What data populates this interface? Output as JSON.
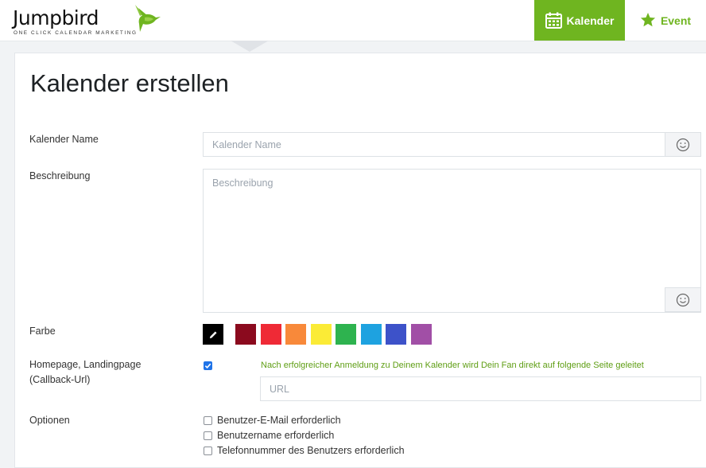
{
  "header": {
    "logo_text": "Jumpbird",
    "logo_tagline": "ONE CLICK CALENDAR MARKETING",
    "nav": [
      {
        "label": "Kalender",
        "icon": "calendar-icon",
        "active": true
      },
      {
        "label": "Event",
        "icon": "star-icon",
        "active": false
      }
    ],
    "accent_color": "#6fb520"
  },
  "page": {
    "title": "Kalender erstellen"
  },
  "form": {
    "name": {
      "label": "Kalender Name",
      "placeholder": "Kalender Name",
      "value": ""
    },
    "description": {
      "label": "Beschreibung",
      "placeholder": "Beschreibung",
      "value": ""
    },
    "color": {
      "label": "Farbe",
      "selected": "#000000",
      "swatches": [
        "#000000",
        "#8b0a1e",
        "#ef2a36",
        "#f8893a",
        "#fbeb36",
        "#2eb34f",
        "#1ea2e0",
        "#3d52c9",
        "#a14fa6"
      ]
    },
    "callback": {
      "label_line1": "Homepage, Landingpage",
      "label_line2": "(Callback-Url)",
      "checked": true,
      "hint": "Nach erfolgreicher Anmeldung zu Deinem Kalender wird Dein Fan direkt auf folgende Seite geleitet",
      "placeholder": "URL",
      "value": ""
    },
    "options": {
      "label": "Optionen",
      "items": [
        {
          "label": "Benutzer-E-Mail erforderlich",
          "checked": false
        },
        {
          "label": "Benutzername erforderlich",
          "checked": false
        },
        {
          "label": "Telefonnummer des Benutzers erforderlich",
          "checked": false
        }
      ]
    }
  }
}
